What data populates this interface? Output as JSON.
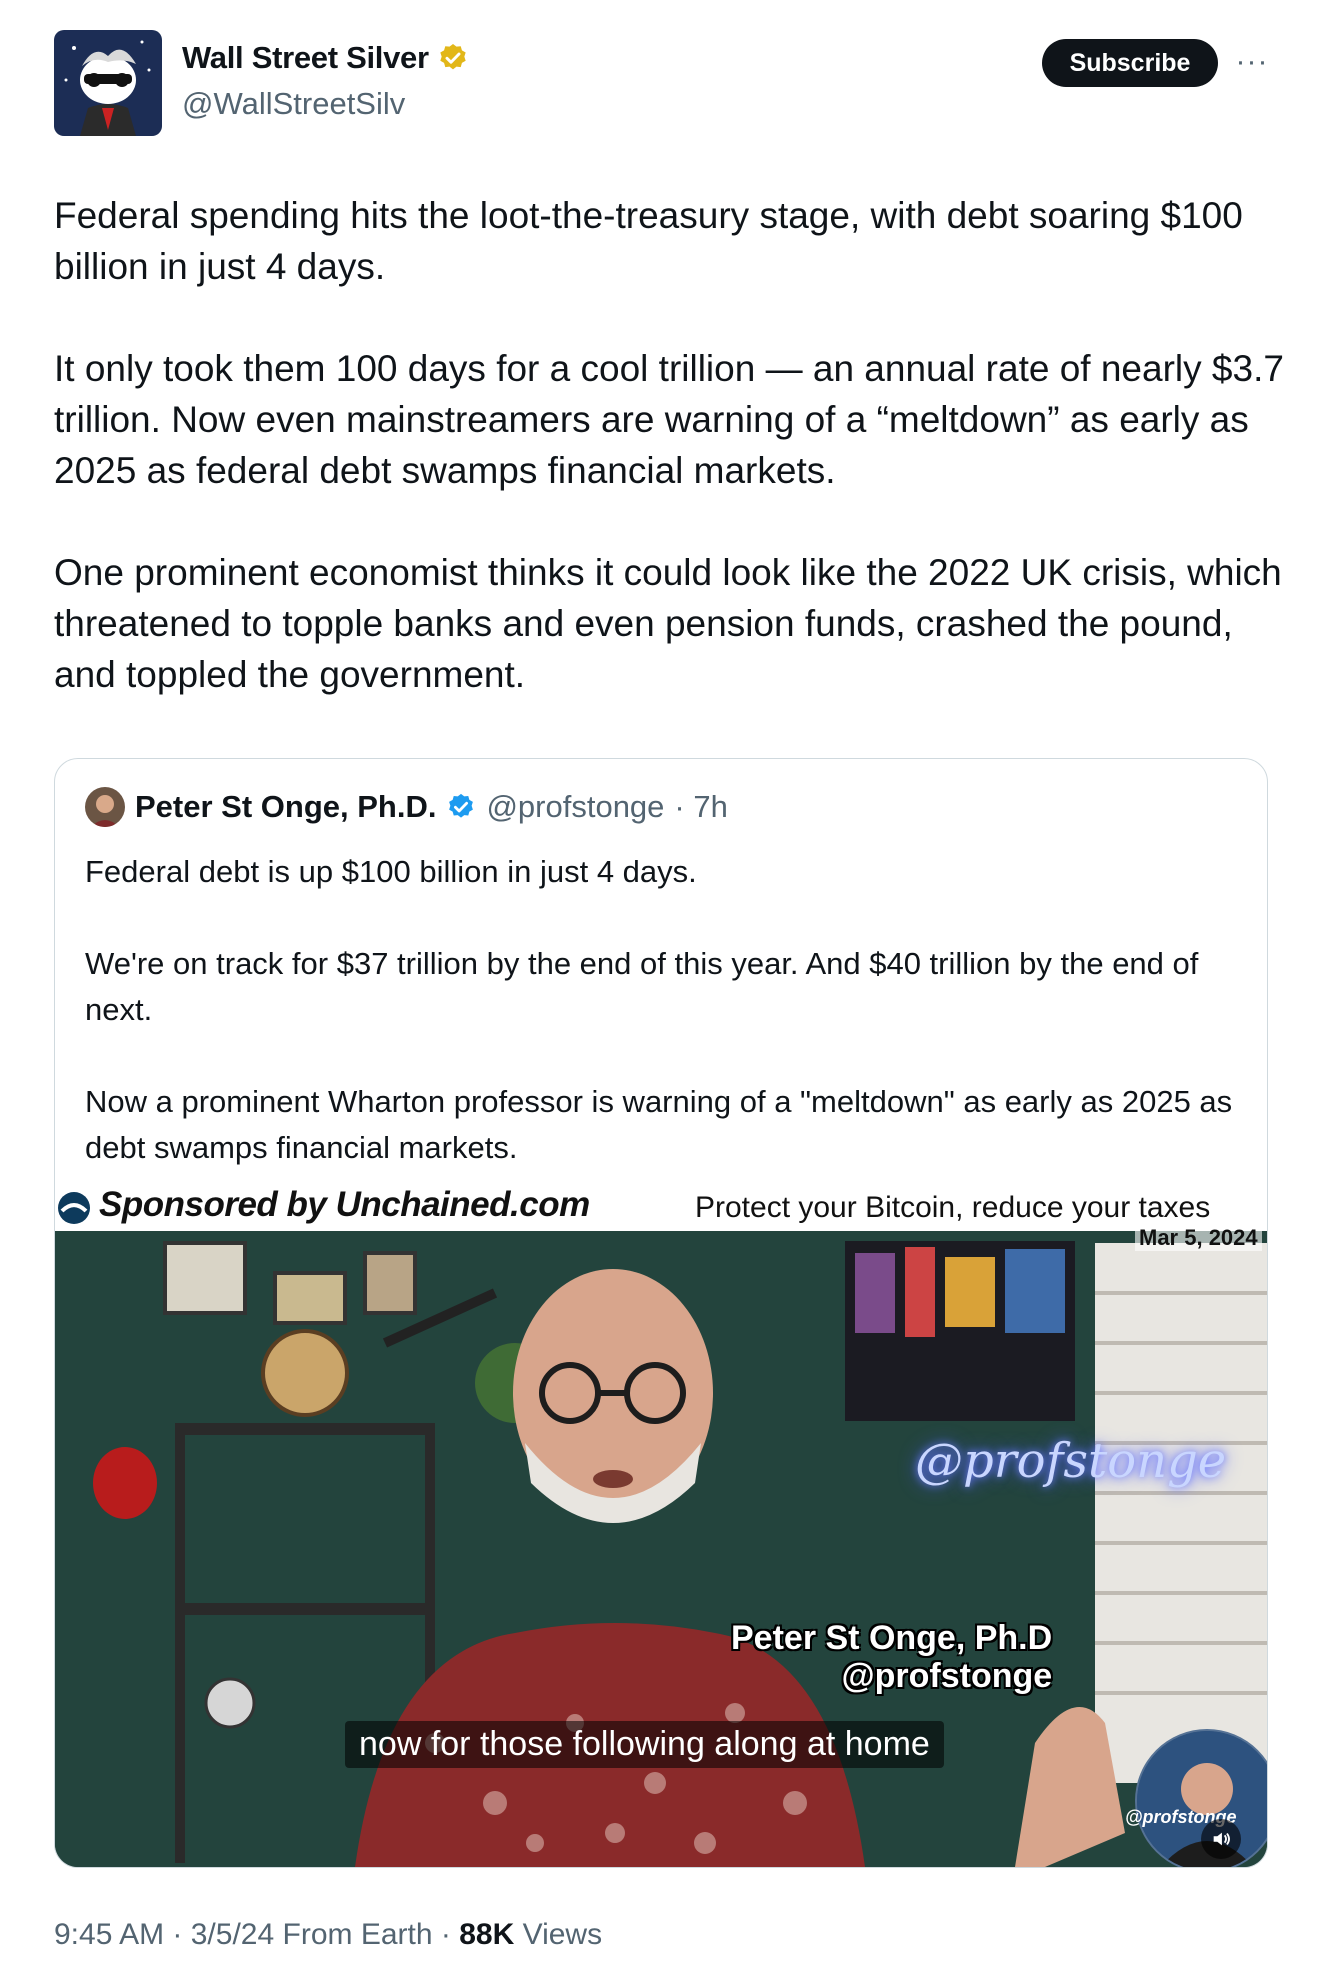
{
  "author": {
    "name": "Wall Street Silver",
    "handle": "@WallStreetSilv",
    "verified_badge": "gold-check-badge-icon",
    "avatar": "wallstreetbets-mascot-avatar"
  },
  "actions": {
    "subscribe_label": "Subscribe",
    "more_icon": "more-options-icon",
    "more_label": "···"
  },
  "tweet": {
    "paragraphs": [
      "Federal spending hits the loot-the-treasury stage, with debt soaring $100 billion in just 4 days.",
      "It only took them 100 days for a cool trillion — an annual rate of nearly $3.7 trillion.  Now even mainstreamers are warning of a “meltdown” as early as 2025 as federal debt swamps financial markets.",
      "One prominent economist thinks it could look like the 2022 UK crisis, which threatened to topple banks and even pension funds, crashed the pound, and toppled the government."
    ]
  },
  "quote": {
    "name": "Peter St Onge, Ph.D.",
    "handle": "@profstonge",
    "time": "· 7h",
    "verified_badge": "blue-check-badge-icon",
    "paragraphs": [
      "Federal debt is up $100 billion in just 4 days.",
      "We're on track for $37 trillion by the end of this year. And $40 trillion by the end of next.",
      "Now a prominent Wharton professor is warning of a \"meltdown\" as early as 2025 as debt swamps financial markets."
    ],
    "video": {
      "sponsor": "Sponsored by Unchained.com",
      "tagline": "Protect your Bitcoin, reduce your taxes",
      "date": "Mar 5, 2024",
      "neon_sign": "@profstonge",
      "lower_third_name": "Peter St Onge, Ph.D",
      "lower_third_handle": "@profstonge",
      "caption": "now for those following along at home",
      "pip_label": "@profstonge",
      "sound_icon": "speaker-icon"
    }
  },
  "meta": {
    "time": "9:45 AM",
    "date": "3/5/24",
    "source": "From Earth",
    "views_count": "88K",
    "views_label": "Views",
    "separator": " · "
  },
  "colors": {
    "text": "#0f1419",
    "secondary": "#536471",
    "border": "#cfd9de",
    "verified_blue": "#1d9bf0",
    "verified_gold": "#e2b719"
  }
}
